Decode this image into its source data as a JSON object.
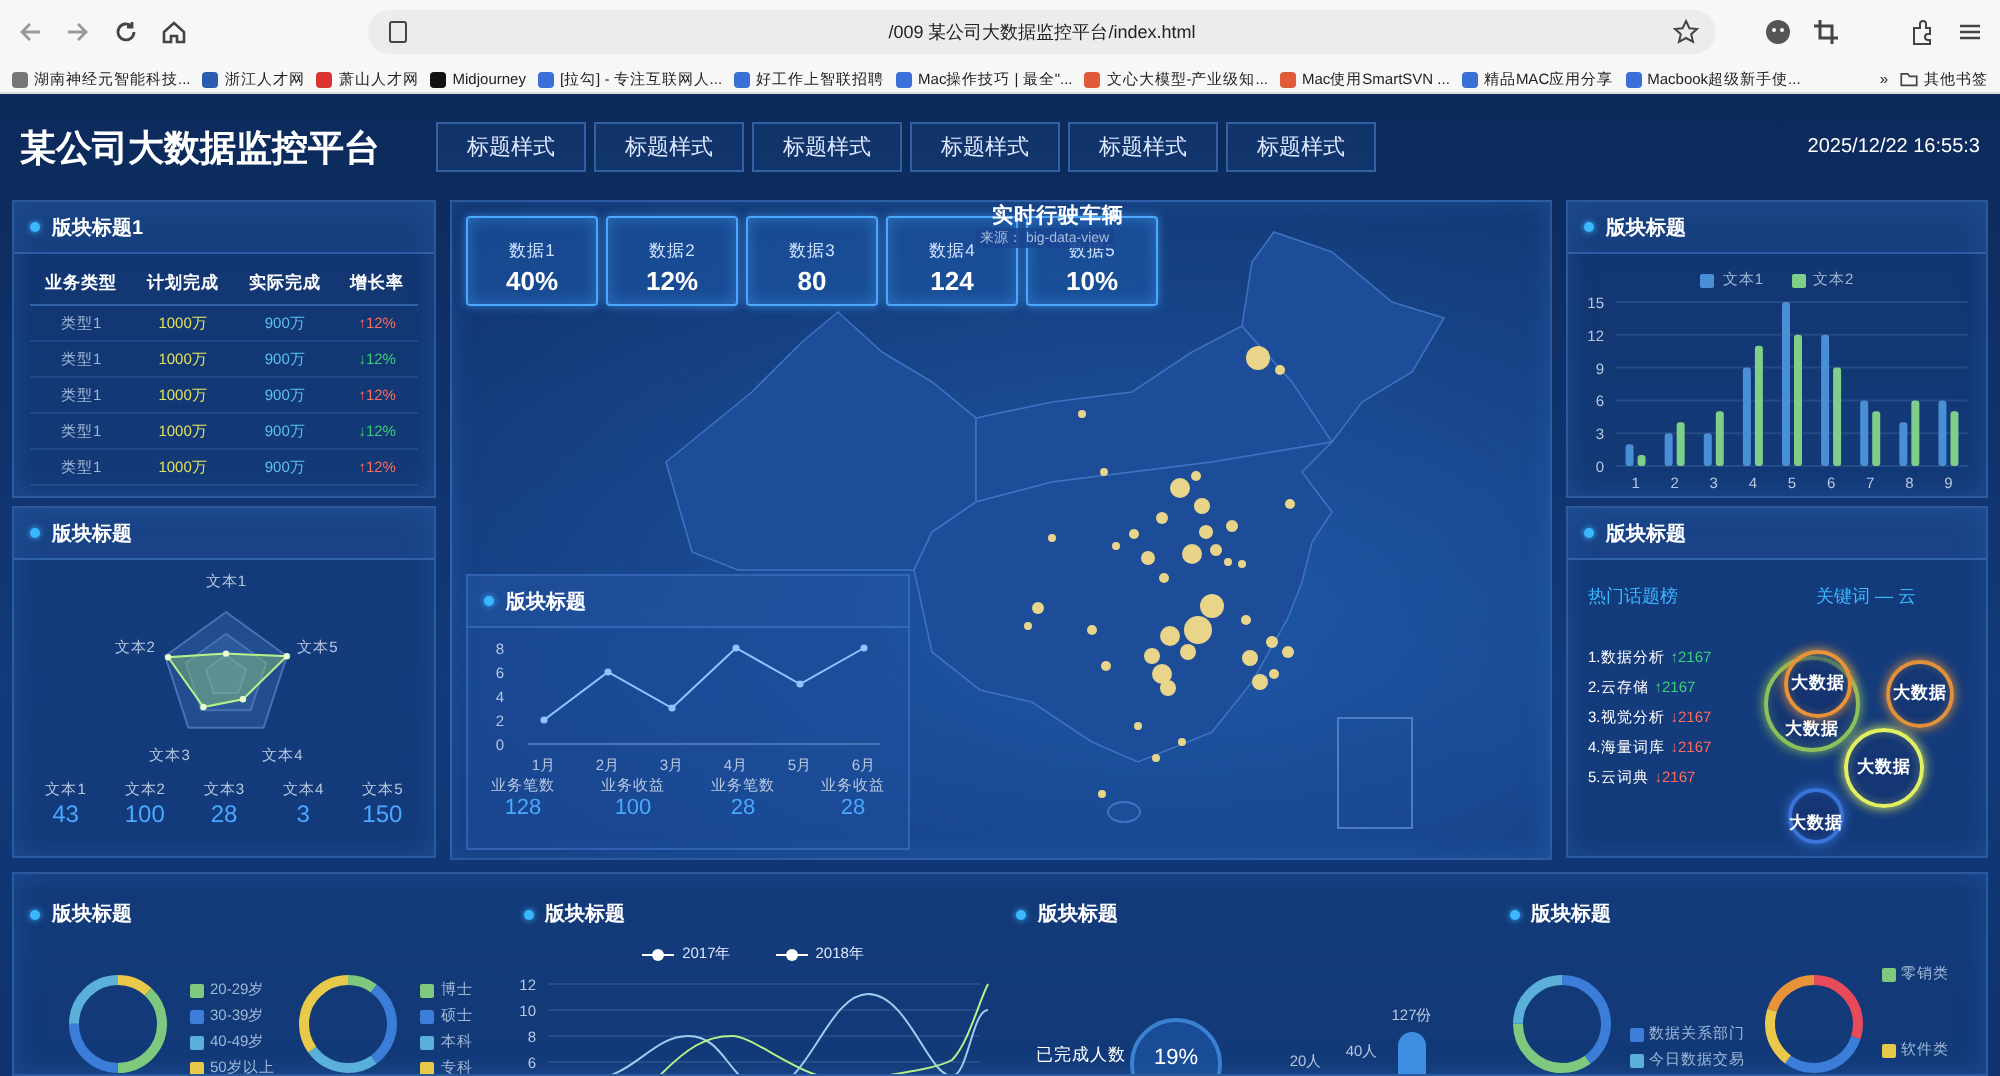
{
  "browser": {
    "url": "/009 某公司大数据监控平台/index.html",
    "bookmarks": [
      "湖南神经元智能科技...",
      "浙江人才网",
      "萧山人才网",
      "Midjourney",
      "[拉勾] - 专注互联网人...",
      "好工作上智联招聘",
      "Mac操作技巧 | 最全\"...",
      "文心大模型-产业级知...",
      "Mac使用SmartSVN ...",
      "精品MAC应用分享",
      "Macbook超级新手使..."
    ],
    "more": "»",
    "other_bookmarks": "其他书签"
  },
  "header": {
    "title": "某公司大数据监控平台",
    "tabs": [
      "标题样式",
      "标题样式",
      "标题样式",
      "标题样式",
      "标题样式",
      "标题样式"
    ],
    "datetime": "2025/12/22 16:55:3"
  },
  "table_panel": {
    "title": "版块标题1",
    "columns": [
      "业务类型",
      "计划完成",
      "实际完成",
      "增长率"
    ],
    "rows": [
      {
        "type": "类型1",
        "plan": "1000万",
        "actual": "900万",
        "rate": "↑12%",
        "color": "#ff6b5b"
      },
      {
        "type": "类型1",
        "plan": "1000万",
        "actual": "900万",
        "rate": "↓12%",
        "color": "#3ccf7a"
      },
      {
        "type": "类型1",
        "plan": "1000万",
        "actual": "900万",
        "rate": "↑12%",
        "color": "#ff6b5b"
      },
      {
        "type": "类型1",
        "plan": "1000万",
        "actual": "900万",
        "rate": "↓12%",
        "color": "#3ccf7a"
      },
      {
        "type": "类型1",
        "plan": "1000万",
        "actual": "900万",
        "rate": "↑12%",
        "color": "#ff6b5b"
      }
    ]
  },
  "radar_panel": {
    "title": "版块标题",
    "axes": [
      "文本1",
      "文本2",
      "文本3",
      "文本4",
      "文本5"
    ],
    "stats": [
      {
        "label": "文本1",
        "value": "43"
      },
      {
        "label": "文本2",
        "value": "100"
      },
      {
        "label": "文本3",
        "value": "28"
      },
      {
        "label": "文本4",
        "value": "3"
      },
      {
        "label": "文本5",
        "value": "150"
      }
    ]
  },
  "map_panel": {
    "kpis": [
      {
        "label": "数据1",
        "value": "40%"
      },
      {
        "label": "数据2",
        "value": "12%"
      },
      {
        "label": "数据3",
        "value": "80"
      },
      {
        "label": "数据4",
        "value": "124"
      },
      {
        "label": "数据5",
        "value": "10%"
      }
    ],
    "title": "实时行驶车辆",
    "source": "来源： big-data-view",
    "line_panel": {
      "title": "版块标题",
      "chart_data": {
        "type": "line",
        "categories": [
          "1月",
          "2月",
          "3月",
          "4月",
          "5月",
          "6月"
        ],
        "series": [
          {
            "color": "#8fc4ff",
            "marker": true,
            "values": [
              2,
              6,
              3,
              8,
              5,
              8
            ]
          }
        ],
        "ylim": [
          0,
          8
        ],
        "yticks": [
          0,
          2,
          4,
          6,
          8
        ]
      },
      "stats": [
        {
          "label": "业务笔数",
          "value": "128"
        },
        {
          "label": "业务收益",
          "value": "100"
        },
        {
          "label": "业务笔数",
          "value": "28"
        },
        {
          "label": "业务收益",
          "value": "28"
        }
      ]
    }
  },
  "bar_panel": {
    "title": "版块标题",
    "chart_data": {
      "type": "bar",
      "categories": [
        "1",
        "2",
        "3",
        "4",
        "5",
        "6",
        "7",
        "8",
        "9"
      ],
      "series": [
        {
          "name": "文本1",
          "color": "#4a8fd6",
          "values": [
            2,
            3,
            3,
            9,
            15,
            12,
            6,
            4,
            6
          ]
        },
        {
          "name": "文本2",
          "color": "#7fcf8a",
          "values": [
            1,
            4,
            5,
            11,
            12,
            9,
            5,
            6,
            5
          ]
        }
      ],
      "grid": true,
      "ylim": [
        0,
        15
      ],
      "yticks": [
        0,
        3,
        6,
        9,
        12,
        15
      ]
    }
  },
  "topic_panel": {
    "title": "版块标题",
    "list_title": "热门话题榜",
    "cloud_title": "关键词 — 云",
    "topics": [
      {
        "name": "1.数据分析",
        "count": "↑2167",
        "color": "#3ccf7a"
      },
      {
        "name": "2.云存储",
        "count": "↑2167",
        "color": "#3ccf7a"
      },
      {
        "name": "3.视觉分析",
        "count": "↓2167",
        "color": "#ff6b5b"
      },
      {
        "name": "4.海量词库",
        "count": "↓2167",
        "color": "#ff6b5b"
      },
      {
        "name": "5.云词典",
        "count": "↓2167",
        "color": "#ff6b5b"
      }
    ],
    "bubbles": [
      {
        "text": "大数据",
        "color": "#e8923a"
      },
      {
        "text": "大数据",
        "color": "#8cc05a"
      },
      {
        "text": "大数据",
        "color": "#e0913a"
      },
      {
        "text": "大数据",
        "color": "#e4f060"
      },
      {
        "text": "大数据",
        "color": "#3a74d8"
      }
    ]
  },
  "bottom": {
    "age_panel": {
      "title": "版块标题",
      "legends": [
        [
          {
            "label": "20-29岁",
            "color": "#7fc97f"
          },
          {
            "label": "30-39岁",
            "color": "#3b7dd8"
          },
          {
            "label": "40-49岁",
            "color": "#5ab0d8"
          },
          {
            "label": "50岁以上",
            "color": "#e8c94a"
          }
        ],
        [
          {
            "label": "博士",
            "color": "#7fc97f"
          },
          {
            "label": "硕士",
            "color": "#3b7dd8"
          },
          {
            "label": "本科",
            "color": "#5ab0d8"
          },
          {
            "label": "专科",
            "color": "#e8c94a"
          }
        ]
      ]
    },
    "trend_panel": {
      "title": "版块标题",
      "legend": [
        "2017年",
        "2018年"
      ],
      "y_ticks": [
        "12",
        "10",
        "8",
        "6"
      ]
    },
    "progress_panel": {
      "title": "版块标题",
      "done_label": "已完成人数",
      "percent": "19%",
      "bar_labels": [
        "127份",
        "40人",
        "20人"
      ]
    },
    "category_panel": {
      "title": "版块标题",
      "left_legend": [
        {
          "label": "数据关系部门",
          "color": "#3b7dd8"
        },
        {
          "label": "今日数据交易",
          "color": "#5ab0d8"
        }
      ],
      "right_legend": [
        {
          "label": "零销类",
          "color": "#7fc97f"
        },
        {
          "label": "软件类",
          "color": "#e8c94a"
        }
      ]
    }
  }
}
